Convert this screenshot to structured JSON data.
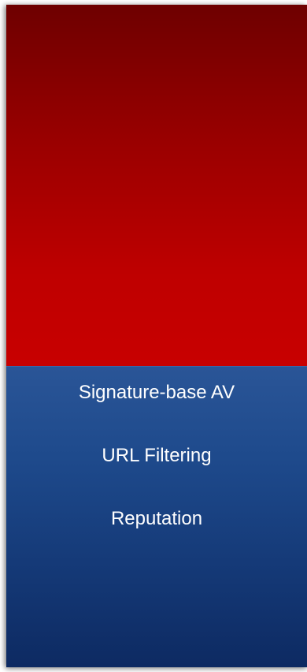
{
  "diagram": {
    "top_block": {
      "label": "",
      "color": "#c80000"
    },
    "bottom_block": {
      "color": "#1e4a8c",
      "items": [
        "Signature-base AV",
        "URL Filtering",
        "Reputation"
      ]
    }
  }
}
